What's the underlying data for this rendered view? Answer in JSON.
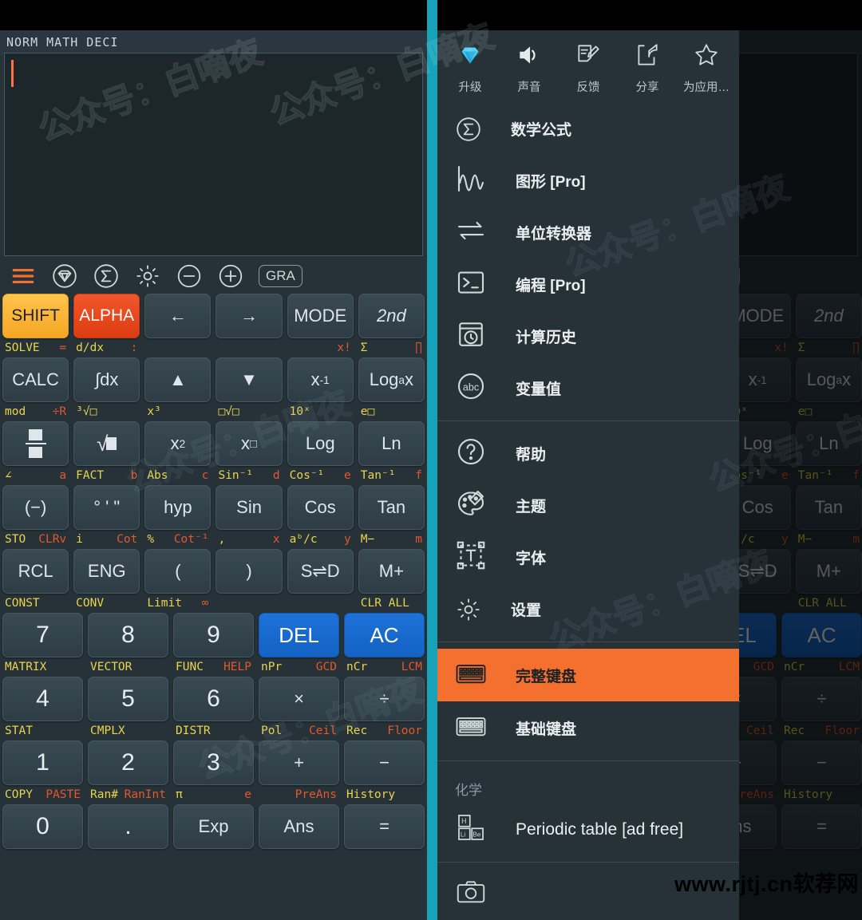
{
  "display": {
    "modes": "NORM  MATH  DECI",
    "expression": ""
  },
  "toolbar": {
    "icons": [
      {
        "name": "menu-icon",
        "label": "menu"
      },
      {
        "name": "diamond-circle-icon",
        "label": "premium"
      },
      {
        "name": "sigma-circle-icon",
        "label": "formulas"
      },
      {
        "name": "gear-icon",
        "label": "settings"
      },
      {
        "name": "minus-circle-icon",
        "label": "zoom-out"
      },
      {
        "name": "plus-circle-icon",
        "label": "zoom-in"
      }
    ],
    "gra_label": "GRA"
  },
  "keypad": {
    "rows": [
      {
        "hints": [],
        "keys": [
          {
            "label": "SHIFT",
            "style": "shift"
          },
          {
            "label": "ALPHA",
            "style": "alpha"
          },
          {
            "label": "←",
            "style": ""
          },
          {
            "label": "→",
            "style": ""
          },
          {
            "label": "MODE",
            "style": ""
          },
          {
            "label": "2nd",
            "style": "italic"
          }
        ]
      },
      {
        "hints": [
          {
            "a": "SOLVE",
            "b": "="
          },
          {
            "a": "d/dx",
            "b": ":"
          },
          {
            "a": "",
            "b": ""
          },
          {
            "a": "",
            "b": ""
          },
          {
            "a": "",
            "b": "x!"
          },
          {
            "a": "Σ",
            "b": "∏"
          }
        ],
        "keys": [
          {
            "label": "CALC",
            "style": ""
          },
          {
            "label": "∫dx",
            "style": ""
          },
          {
            "label": "▲",
            "style": ""
          },
          {
            "label": "▼",
            "style": ""
          },
          {
            "label": "x⁻¹",
            "style": ""
          },
          {
            "label": "Logₐx",
            "style": ""
          }
        ]
      },
      {
        "hints": [
          {
            "a": "mod",
            "b": "÷R"
          },
          {
            "a": "³√□",
            "b": ""
          },
          {
            "a": "x³",
            "b": ""
          },
          {
            "a": "□√□",
            "b": ""
          },
          {
            "a": "10ˣ",
            "b": ""
          },
          {
            "a": "e□",
            "b": ""
          }
        ],
        "keys": [
          {
            "label": "■/■",
            "style": "fraction"
          },
          {
            "label": "√□",
            "style": ""
          },
          {
            "label": "x²",
            "style": ""
          },
          {
            "label": "x□",
            "style": ""
          },
          {
            "label": "Log",
            "style": ""
          },
          {
            "label": "Ln",
            "style": ""
          }
        ]
      },
      {
        "hints": [
          {
            "a": "∠",
            "b": "a"
          },
          {
            "a": "FACT",
            "b": "b"
          },
          {
            "a": "Abs",
            "b": "c"
          },
          {
            "a": "Sin⁻¹",
            "b": "d"
          },
          {
            "a": "Cos⁻¹",
            "b": "e"
          },
          {
            "a": "Tan⁻¹",
            "b": "f"
          }
        ],
        "keys": [
          {
            "label": "(−)",
            "style": ""
          },
          {
            "label": "° ' \"",
            "style": ""
          },
          {
            "label": "hyp",
            "style": ""
          },
          {
            "label": "Sin",
            "style": ""
          },
          {
            "label": "Cos",
            "style": ""
          },
          {
            "label": "Tan",
            "style": ""
          }
        ]
      },
      {
        "hints": [
          {
            "a": "STO",
            "b": "CLRv"
          },
          {
            "a": "i",
            "b": "Cot"
          },
          {
            "a": "%",
            "b": "Cot⁻¹"
          },
          {
            "a": ",",
            "b": "x"
          },
          {
            "a": "aᵇ/c",
            "b": "y"
          },
          {
            "a": "M−",
            "b": "m"
          }
        ],
        "keys": [
          {
            "label": "RCL",
            "style": ""
          },
          {
            "label": "ENG",
            "style": ""
          },
          {
            "label": "(",
            "style": ""
          },
          {
            "label": ")",
            "style": ""
          },
          {
            "label": "S⇌D",
            "style": ""
          },
          {
            "label": "M+",
            "style": ""
          }
        ]
      },
      {
        "hints": [
          {
            "a": "CONST",
            "b": ""
          },
          {
            "a": "CONV",
            "b": ""
          },
          {
            "a": "Limit",
            "b": "∞"
          },
          {
            "a": "",
            "b": ""
          },
          {
            "a": "",
            "b": ""
          },
          {
            "a": "CLR ALL",
            "b": ""
          }
        ],
        "keys": [
          {
            "label": "7",
            "style": "num"
          },
          {
            "label": "8",
            "style": "num"
          },
          {
            "label": "9",
            "style": "num"
          },
          {
            "label": "DEL",
            "style": "blue"
          },
          {
            "label": "AC",
            "style": "blue"
          }
        ]
      },
      {
        "hints": [
          {
            "a": "MATRIX",
            "b": ""
          },
          {
            "a": "VECTOR",
            "b": ""
          },
          {
            "a": "FUNC",
            "b": "HELP"
          },
          {
            "a": "nPr",
            "b": "GCD"
          },
          {
            "a": "nCr",
            "b": "LCM"
          }
        ],
        "keys": [
          {
            "label": "4",
            "style": "num"
          },
          {
            "label": "5",
            "style": "num"
          },
          {
            "label": "6",
            "style": "num"
          },
          {
            "label": "×",
            "style": ""
          },
          {
            "label": "÷",
            "style": ""
          }
        ]
      },
      {
        "hints": [
          {
            "a": "STAT",
            "b": ""
          },
          {
            "a": "CMPLX",
            "b": ""
          },
          {
            "a": "DISTR",
            "b": ""
          },
          {
            "a": "Pol",
            "b": "Ceil"
          },
          {
            "a": "Rec",
            "b": "Floor"
          }
        ],
        "keys": [
          {
            "label": "1",
            "style": "num"
          },
          {
            "label": "2",
            "style": "num"
          },
          {
            "label": "3",
            "style": "num"
          },
          {
            "label": "+",
            "style": ""
          },
          {
            "label": "−",
            "style": ""
          }
        ]
      },
      {
        "hints": [
          {
            "a": "COPY",
            "b": "PASTE"
          },
          {
            "a": "Ran#",
            "b": "RanInt"
          },
          {
            "a": "π",
            "b": "e"
          },
          {
            "a": "",
            "b": "PreAns"
          },
          {
            "a": "History",
            "b": ""
          }
        ],
        "keys": [
          {
            "label": "0",
            "style": "num"
          },
          {
            "label": ".",
            "style": "num"
          },
          {
            "label": "Exp",
            "style": ""
          },
          {
            "label": "Ans",
            "style": ""
          },
          {
            "label": "=",
            "style": ""
          }
        ]
      }
    ]
  },
  "drawer": {
    "quick_actions": [
      {
        "icon": "diamond-icon",
        "label": "升级"
      },
      {
        "icon": "speaker-icon",
        "label": "声音"
      },
      {
        "icon": "feedback-icon",
        "label": "反馈"
      },
      {
        "icon": "share-icon",
        "label": "分享"
      },
      {
        "icon": "star-icon",
        "label": "为应用…"
      }
    ],
    "group1": [
      {
        "icon": "sigma-circle-icon",
        "label": "数学公式"
      },
      {
        "icon": "graph-icon",
        "label": "图形 [Pro]"
      },
      {
        "icon": "unit-convert-icon",
        "label": "单位转换器"
      },
      {
        "icon": "terminal-icon",
        "label": "编程 [Pro]"
      },
      {
        "icon": "history-icon",
        "label": "计算历史"
      },
      {
        "icon": "abc-circle-icon",
        "label": "变量值"
      }
    ],
    "group2": [
      {
        "icon": "help-circle-icon",
        "label": "帮助"
      },
      {
        "icon": "palette-icon",
        "label": "主题"
      },
      {
        "icon": "font-icon",
        "label": "字体"
      },
      {
        "icon": "gear-icon",
        "label": "设置"
      }
    ],
    "keyboards": [
      {
        "icon": "keyboard-icon",
        "label": "完整键盘",
        "selected": true
      },
      {
        "icon": "keyboard-icon",
        "label": "基础键盘",
        "selected": false
      }
    ],
    "chemistry_section_label": "化学",
    "chemistry": [
      {
        "icon": "periodic-table-icon",
        "label": "Periodic table [ad free]"
      }
    ]
  },
  "watermark": {
    "site": "www.rjtj.cn软荐网",
    "overlay": "公众号：白嘀夜"
  },
  "colors": {
    "accent_orange": "#f4702f",
    "shift_yellow": "#f5a623",
    "alpha_red": "#dd3c11",
    "blue": "#1d72d8",
    "teal": "#17a2b8",
    "hint_yellow": "#e8d44d",
    "hint_red": "#e4572e",
    "panel": "#263238"
  }
}
